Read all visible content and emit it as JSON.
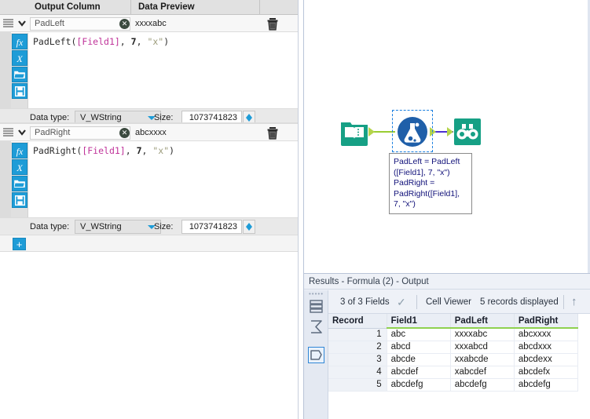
{
  "config": {
    "headers": {
      "output_column": "Output Column",
      "data_preview": "Data Preview"
    },
    "formulas": [
      {
        "output_column": "PadLeft",
        "preview": "xxxxabc",
        "expression_fn": "PadLeft",
        "expression_field": "[Field1]",
        "expression_num": "7",
        "expression_str": "\"x\"",
        "expression_full": "PadLeft([Field1], 7, \"x\")",
        "data_type_label": "Data type:",
        "data_type_value": "V_WString",
        "size_label": "Size:",
        "size_value": "1073741823"
      },
      {
        "output_column": "PadRight",
        "preview": "abcxxxx",
        "expression_fn": "PadRight",
        "expression_field": "[Field1]",
        "expression_num": "7",
        "expression_str": "\"x\"",
        "expression_full": "PadRight([Field1], 7, \"x\")",
        "data_type_label": "Data type:",
        "data_type_value": "V_WString",
        "size_label": "Size:",
        "size_value": "1073741823"
      }
    ],
    "rail_icons": {
      "fx": "fx",
      "variable": "X",
      "open": "open-folder-icon",
      "save": "save-icon"
    },
    "add_button_label": "+",
    "clear_button_label": "✕",
    "colors": {
      "accent": "#1e9cd7",
      "field_token": "#c0349a",
      "string_token": "#9b9b7a",
      "green_underline": "#8fd14f"
    }
  },
  "canvas": {
    "tooltip_text": "PadLeft = PadLeft([Field1], 7, \"x\") PadRight = PadRight([Field1], 7, \"x\")",
    "tooltip_lines": [
      "PadLeft = PadLeft",
      "([Field1], 7, \"x\")",
      "PadRight =",
      "PadRight([Field1],",
      "7, \"x\")"
    ],
    "nodes": [
      {
        "name": "input-data-tool",
        "icon": "book-icon",
        "color": "#1aa287"
      },
      {
        "name": "formula-tool",
        "icon": "flask-icon",
        "color": "#1763a8"
      },
      {
        "name": "browse-tool",
        "icon": "binoculars-icon",
        "color": "#1aa287"
      }
    ]
  },
  "results": {
    "title": "Results - Formula (2) - Output",
    "toolbar": {
      "fields_label": "3 of 3 Fields",
      "check_icon": "checkmark-icon",
      "cell_viewer_label": "Cell Viewer",
      "records_label": "5 records displayed",
      "up_icon": "arrow-up-icon"
    },
    "rail_icons": {
      "list": "list-view-icon",
      "summary": "sigma-icon",
      "record": "record-shape-icon"
    },
    "table": {
      "columns": [
        "Record",
        "Field1",
        "PadLeft",
        "PadRight"
      ],
      "rows": [
        {
          "Record": "1",
          "Field1": "abc",
          "PadLeft": "xxxxabc",
          "PadRight": "abcxxxx"
        },
        {
          "Record": "2",
          "Field1": "abcd",
          "PadLeft": "xxxabcd",
          "PadRight": "abcdxxx"
        },
        {
          "Record": "3",
          "Field1": "abcde",
          "PadLeft": "xxabcde",
          "PadRight": "abcdexx"
        },
        {
          "Record": "4",
          "Field1": "abcdef",
          "PadLeft": "xabcdef",
          "PadRight": "abcdefx"
        },
        {
          "Record": "5",
          "Field1": "abcdefg",
          "PadLeft": "abcdefg",
          "PadRight": "abcdefg"
        }
      ]
    }
  }
}
